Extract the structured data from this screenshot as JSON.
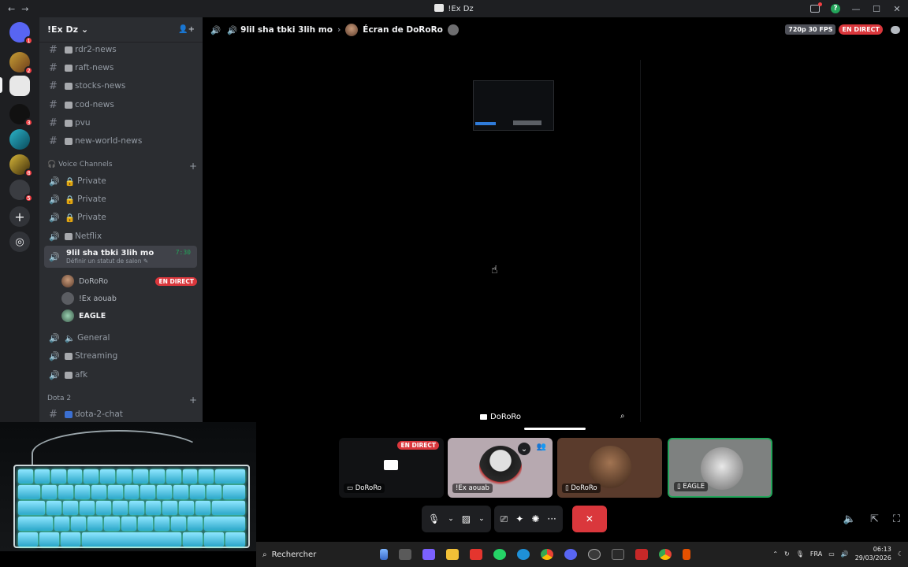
{
  "titlebar": {
    "title": "!Ex Dz",
    "back": "←",
    "forward": "→",
    "minimize": "—",
    "maximize": "☐",
    "close": "✕"
  },
  "rail": {
    "servers": [
      {
        "badge": "1"
      },
      {
        "badge": "2"
      },
      {
        "badge": ""
      },
      {
        "badge": "3"
      },
      {
        "badge": ""
      },
      {
        "badge": "8"
      },
      {
        "badge": "5"
      }
    ],
    "add": "+",
    "discover": "◎"
  },
  "guild": {
    "name": "!Ex Dz",
    "chevron": "⌄",
    "invite_icon": "👤+"
  },
  "text_channels": [
    "rdr2-news",
    "raft-news",
    "stocks-news",
    "cod-news",
    "pvu",
    "new-world-news"
  ],
  "voice_category": "Voice Channels",
  "voice_channels_top": [
    "Private",
    "Private",
    "Private",
    "Netflix"
  ],
  "active_voice": {
    "name": "9lil sha tbki 3lih mo",
    "time": "7:30",
    "status": "Définir un statut de salon"
  },
  "voice_users": [
    {
      "name": "DoRoRo",
      "live": "EN DIRECT"
    },
    {
      "name": "!Ex aouab",
      "live": ""
    },
    {
      "name": "EAGLE",
      "live": ""
    }
  ],
  "voice_channels_bottom": [
    "General",
    "Streaming",
    "afk"
  ],
  "dota_category": "Dota 2",
  "dota_channel": "dota-2-chat",
  "stage": {
    "channel": "9lil sha tbki 3lih mo",
    "screen_title": "Écran de DoRoRo",
    "quality": "720p 30 FPS",
    "live": "EN DIRECT",
    "stream_label": "DoRoRo"
  },
  "tiles": [
    {
      "label": "DoRoRo",
      "live": "EN DIRECT"
    },
    {
      "label": "!Ex aouab",
      "live": ""
    },
    {
      "label": "DoRoRo",
      "live": ""
    },
    {
      "label": "EAGLE",
      "live": ""
    }
  ],
  "taskbar": {
    "search": "Rechercher",
    "lang": "FRA",
    "time": "06:13",
    "date": "29/03/2026"
  }
}
